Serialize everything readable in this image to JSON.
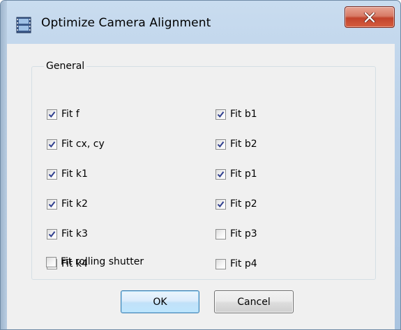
{
  "window": {
    "title": "Optimize Camera Alignment",
    "icon": "film-strip-icon",
    "close_icon": "close-x-icon",
    "close_color": "#c2432c"
  },
  "group": {
    "title": "General",
    "options": [
      {
        "label": "Fit f",
        "checked": true
      },
      {
        "label": "Fit cx, cy",
        "checked": true
      },
      {
        "label": "Fit k1",
        "checked": true
      },
      {
        "label": "Fit k2",
        "checked": true
      },
      {
        "label": "Fit k3",
        "checked": true
      },
      {
        "label": "Fit k4",
        "checked": false
      },
      {
        "label": "Fit rolling shutter",
        "checked": false
      },
      {
        "label": "Fit b1",
        "checked": true
      },
      {
        "label": "Fit b2",
        "checked": true
      },
      {
        "label": "Fit p1",
        "checked": true
      },
      {
        "label": "Fit p2",
        "checked": true
      },
      {
        "label": "Fit p3",
        "checked": false
      },
      {
        "label": "Fit p4",
        "checked": false
      }
    ]
  },
  "buttons": {
    "ok": "OK",
    "cancel": "Cancel"
  },
  "colors": {
    "accent": "#3c7fb1",
    "check": "#2f3e8e"
  }
}
